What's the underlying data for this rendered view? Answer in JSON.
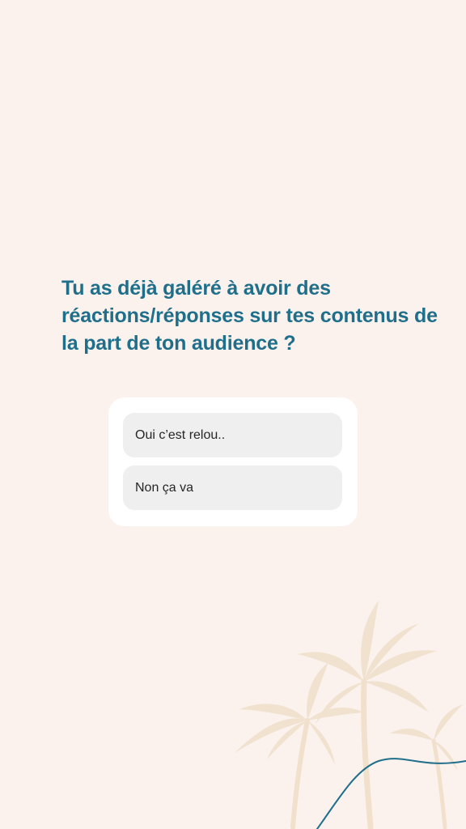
{
  "story": {
    "question": "Tu as déjà galéré à avoir des réactions/réponses sur tes contenus de la part de ton audience ?",
    "poll": {
      "options": [
        {
          "label": "Oui c’est relou.."
        },
        {
          "label": "Non ça va"
        }
      ]
    }
  },
  "colors": {
    "background": "#fbf2ee",
    "question_text": "#1f6f8b",
    "card": "#ffffff",
    "option_fill": "#efefef",
    "option_text": "#262626",
    "palm_decoration": "#f1e1cc",
    "wave_line": "#1f6f8b"
  },
  "decorations": {
    "background_icon": "palm-trees-icon",
    "line_icon": "wave-line-icon"
  }
}
